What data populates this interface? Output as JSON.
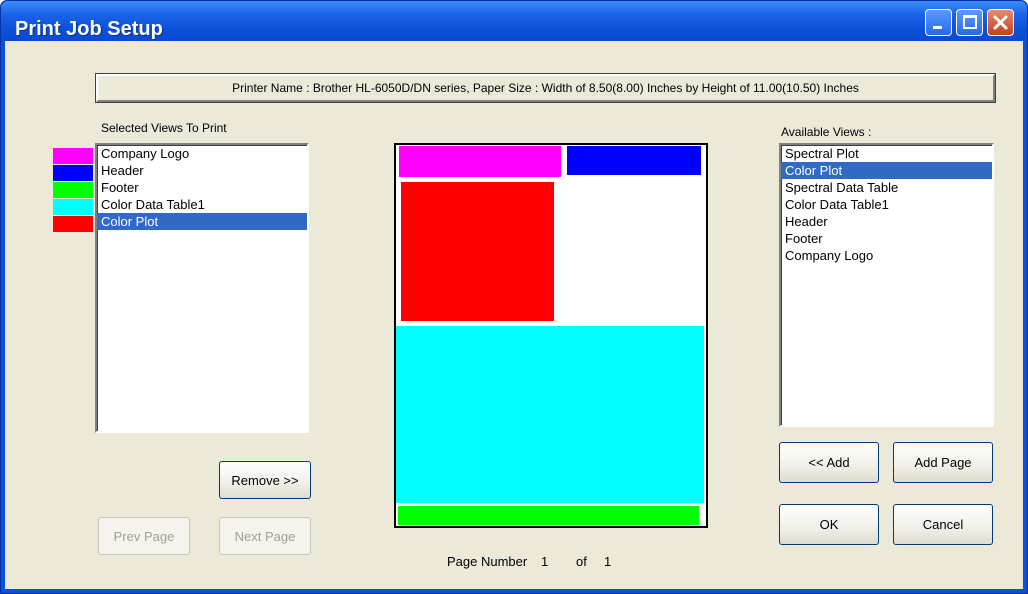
{
  "window": {
    "title": "Print Job Setup"
  },
  "info_bar": {
    "text": "Printer Name : Brother HL-6050D/DN series, Paper Size : Width of 8.50(8.00) Inches by Height of 11.00(10.50) Inches"
  },
  "selected_views": {
    "label": "Selected Views To Print",
    "items": [
      {
        "label": "Company Logo",
        "color": "#ff00ff",
        "selected": false
      },
      {
        "label": "Header",
        "color": "#0000ff",
        "selected": false
      },
      {
        "label": "Footer",
        "color": "#00ff00",
        "selected": false
      },
      {
        "label": "Color Data Table1",
        "color": "#00ffff",
        "selected": false
      },
      {
        "label": "Color Plot",
        "color": "#ff0000",
        "selected": true
      }
    ]
  },
  "available_views": {
    "label": "Available Views :",
    "items": [
      {
        "label": "Spectral Plot",
        "selected": false
      },
      {
        "label": "Color Plot",
        "selected": true
      },
      {
        "label": "Spectral Data Table",
        "selected": false
      },
      {
        "label": "Color Data Table1",
        "selected": false
      },
      {
        "label": "Header",
        "selected": false
      },
      {
        "label": "Footer",
        "selected": false
      },
      {
        "label": "Company Logo",
        "selected": false
      }
    ]
  },
  "buttons": {
    "remove": "Remove >>",
    "prev_page": "Prev Page",
    "next_page": "Next Page",
    "add": "<< Add",
    "add_page": "Add Page",
    "ok": "OK",
    "cancel": "Cancel"
  },
  "page": {
    "label": "Page Number",
    "current": "1",
    "of_label": "of",
    "total": "1"
  },
  "colors": {
    "selection": "#316ac5",
    "dialog_bg": "#ece9d8",
    "title_bar": "#0a52dd"
  }
}
